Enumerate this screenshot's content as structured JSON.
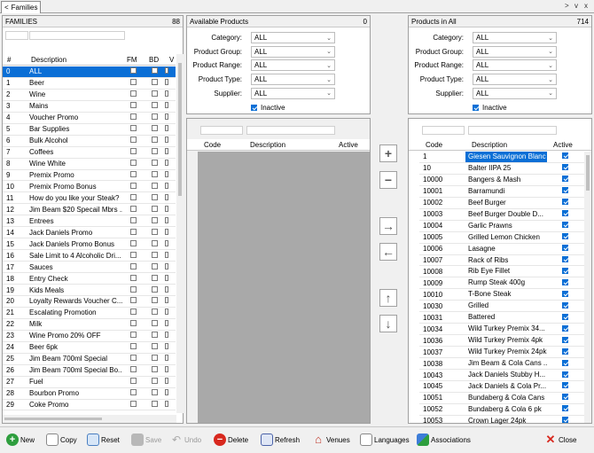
{
  "tab": {
    "nav_left": "<",
    "title": "Families",
    "nav_right": ">",
    "chevron": "v",
    "close": "x"
  },
  "families": {
    "title": "FAMILIES",
    "count": "88",
    "columns": [
      "#",
      "Description",
      "FM",
      "BD",
      "V"
    ],
    "rows": [
      [
        "0",
        "ALL"
      ],
      [
        "1",
        "Beer"
      ],
      [
        "2",
        "Wine"
      ],
      [
        "3",
        "Mains"
      ],
      [
        "4",
        "Voucher Promo"
      ],
      [
        "5",
        "Bar Supplies"
      ],
      [
        "6",
        "Bulk Alcohol"
      ],
      [
        "7",
        "Coffees"
      ],
      [
        "8",
        "Wine White"
      ],
      [
        "9",
        "Premix Promo"
      ],
      [
        "10",
        "Premix Promo Bonus"
      ],
      [
        "11",
        "How do you like your Steak?"
      ],
      [
        "12",
        "Jim Beam $20 Specail Mbrs ..."
      ],
      [
        "13",
        "Entrees"
      ],
      [
        "14",
        "Jack Daniels Promo"
      ],
      [
        "15",
        "Jack Daniels Promo Bonus"
      ],
      [
        "16",
        "Sale Limit to 4 Alcoholic Dri..."
      ],
      [
        "17",
        "Sauces"
      ],
      [
        "18",
        "Entry Check"
      ],
      [
        "19",
        "Kids Meals"
      ],
      [
        "20",
        "Loyalty Rewards Voucher C..."
      ],
      [
        "21",
        "Escalating Promotion"
      ],
      [
        "22",
        "Milk"
      ],
      [
        "23",
        "Wine Promo 20% OFF"
      ],
      [
        "24",
        "Beer 6pk"
      ],
      [
        "25",
        "Jim Beam 700ml Special"
      ],
      [
        "26",
        "Jim Beam 700ml Special Bo..."
      ],
      [
        "27",
        "Fuel"
      ],
      [
        "28",
        "Bourbon Promo"
      ],
      [
        "29",
        "Coke Promo"
      ]
    ]
  },
  "available": {
    "title": "Available Products",
    "count": "0",
    "filters": [
      {
        "label": "Category:",
        "value": "ALL"
      },
      {
        "label": "Product Group:",
        "value": "ALL"
      },
      {
        "label": "Product Range:",
        "value": "ALL"
      },
      {
        "label": "Product Type:",
        "value": "ALL"
      },
      {
        "label": "Supplier:",
        "value": "ALL"
      }
    ],
    "inactive_label": "Inactive",
    "columns": [
      "Code",
      "Description",
      "Active"
    ]
  },
  "inall": {
    "title": "Products in All",
    "count": "714",
    "filters": [
      {
        "label": "Category:",
        "value": "ALL"
      },
      {
        "label": "Product Group:",
        "value": "ALL"
      },
      {
        "label": "Product Range:",
        "value": "ALL"
      },
      {
        "label": "Product Type:",
        "value": "ALL"
      },
      {
        "label": "Supplier:",
        "value": "ALL"
      }
    ],
    "inactive_label": "Inactive",
    "columns": [
      "Code",
      "Description",
      "Active"
    ],
    "rows": [
      [
        "1",
        "Giesen Sauvignon Blanc"
      ],
      [
        "10",
        "Balter IIPA 25"
      ],
      [
        "10000",
        "Bangers & Mash"
      ],
      [
        "10001",
        "Barramundi"
      ],
      [
        "10002",
        "Beef Burger"
      ],
      [
        "10003",
        "Beef Burger Double D..."
      ],
      [
        "10004",
        "Garlic Prawns"
      ],
      [
        "10005",
        "Grilled Lemon Chicken"
      ],
      [
        "10006",
        "Lasagne"
      ],
      [
        "10007",
        "Rack of Ribs"
      ],
      [
        "10008",
        "Rib Eye Fillet"
      ],
      [
        "10009",
        "Rump Steak 400g"
      ],
      [
        "10010",
        "T-Bone Steak"
      ],
      [
        "10030",
        "Grilled"
      ],
      [
        "10031",
        "Battered"
      ],
      [
        "10034",
        "Wild Turkey Premix 34..."
      ],
      [
        "10036",
        "Wild Turkey Premix 4pk"
      ],
      [
        "10037",
        "Wild Turkey Premix 24pk"
      ],
      [
        "10038",
        "Jim Beam & Cola Cans ..."
      ],
      [
        "10043",
        "Jack Daniels Stubby H..."
      ],
      [
        "10045",
        "Jack Daniels & Cola Pr..."
      ],
      [
        "10051",
        "Bundaberg & Cola Cans"
      ],
      [
        "10052",
        "Bundaberg & Cola 6 pk"
      ],
      [
        "10053",
        "Crown Lager 24pk"
      ]
    ]
  },
  "toolbar": {
    "new": "New",
    "copy": "Copy",
    "reset": "Reset",
    "save": "Save",
    "undo": "Undo",
    "delete": "Delete",
    "refresh": "Refresh",
    "venues": "Venues",
    "languages": "Languages",
    "associations": "Associations",
    "close": "Close"
  }
}
